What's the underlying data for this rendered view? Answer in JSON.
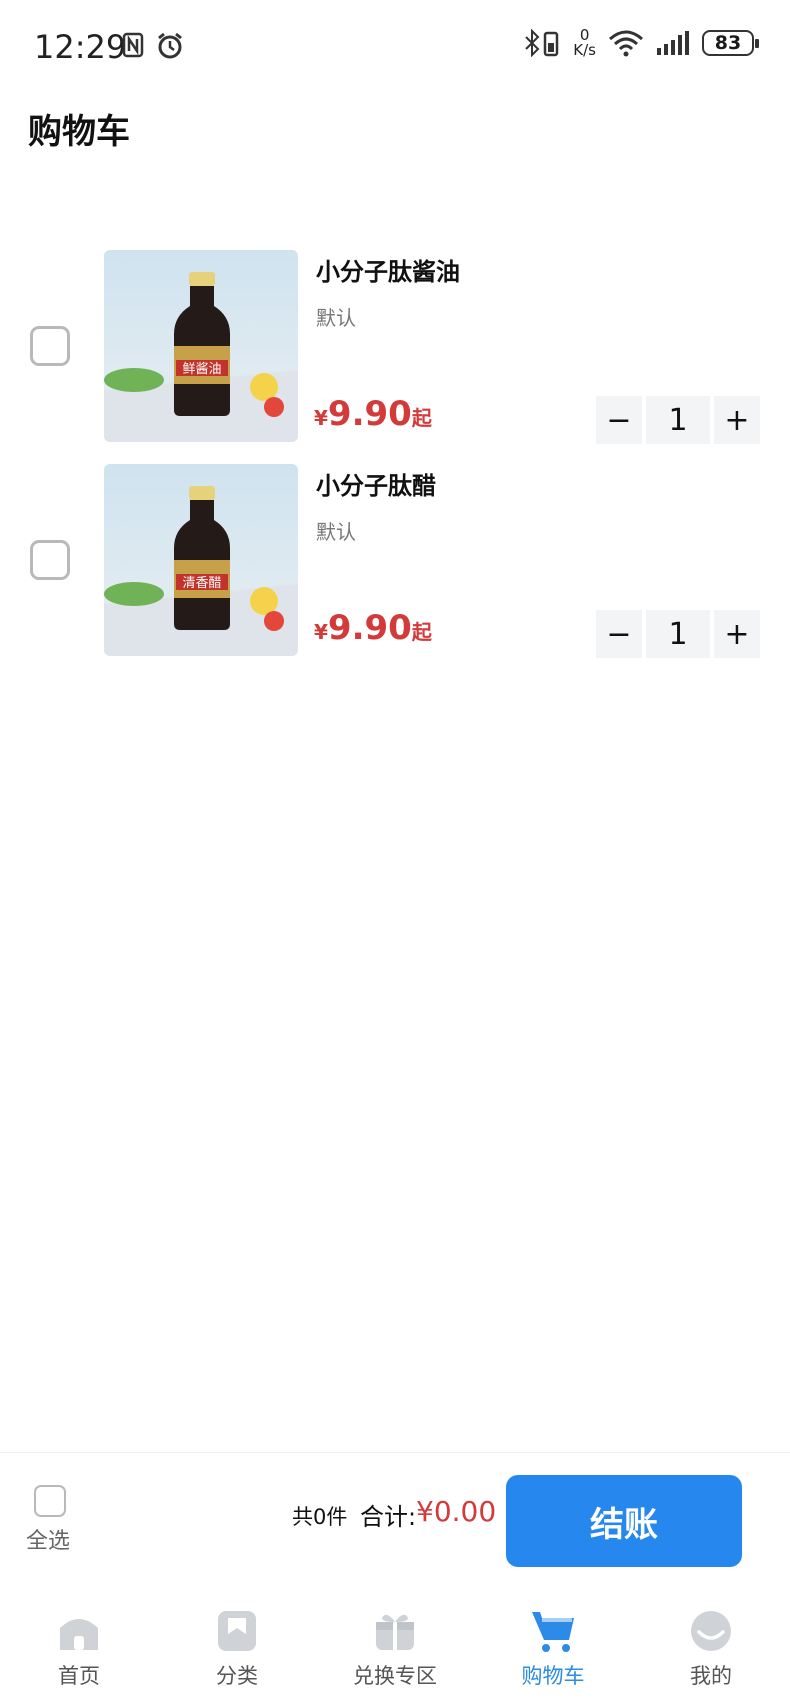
{
  "status_bar": {
    "time": "12:29",
    "speed_value": "0",
    "speed_unit": "K/s",
    "battery": "83"
  },
  "header": {
    "title": "购物车"
  },
  "cart": {
    "items": [
      {
        "name": "小分子肽酱油",
        "spec": "默认",
        "currency": "¥",
        "price": "9.90",
        "price_suffix": "起",
        "quantity": "1",
        "label_text": "鲜酱油"
      },
      {
        "name": "小分子肽醋",
        "spec": "默认",
        "currency": "¥",
        "price": "9.90",
        "price_suffix": "起",
        "quantity": "1",
        "label_text": "清香醋"
      }
    ],
    "minus_symbol": "−",
    "plus_symbol": "+"
  },
  "summary": {
    "select_all_label": "全选",
    "count_text": "共0件",
    "total_label": "合计:",
    "total_value": "¥0.00",
    "checkout_label": "结账"
  },
  "tabs": [
    {
      "label": "首页",
      "icon": "home-icon"
    },
    {
      "label": "分类",
      "icon": "category-icon"
    },
    {
      "label": "兑换专区",
      "icon": "gift-icon"
    },
    {
      "label": "购物车",
      "icon": "cart-icon",
      "active": true
    },
    {
      "label": "我的",
      "icon": "profile-icon"
    }
  ],
  "colors": {
    "accent": "#2687ee",
    "price": "#d33a3a",
    "active_tab": "#2b8be6"
  }
}
